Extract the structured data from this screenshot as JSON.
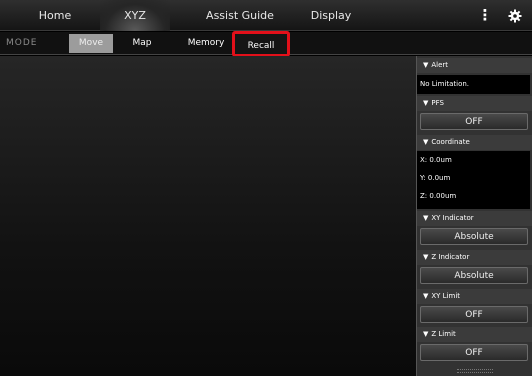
{
  "topnav": {
    "home": "Home",
    "xyz": "XYZ",
    "assist_guide": "Assist Guide",
    "display": "Display",
    "more_icon": "vertical-ellipsis",
    "settings_icon": "gear"
  },
  "modebar": {
    "label": "MODE",
    "tabs": [
      "Move",
      "Map",
      "Memory",
      "Recall"
    ],
    "selected": "Move",
    "highlighted": "Recall"
  },
  "panel": {
    "alert": {
      "header": "Alert",
      "text": "No Limitation."
    },
    "pfs": {
      "header": "PFS",
      "value": "OFF"
    },
    "coordinate": {
      "header": "Coordinate",
      "x": "X: 0.0um",
      "y": "Y: 0.0um",
      "z": "Z: 0.00um"
    },
    "xy_indicator": {
      "header": "XY Indicator",
      "value": "Absolute"
    },
    "z_indicator": {
      "header": "Z Indicator",
      "value": "Absolute"
    },
    "xy_limit": {
      "header": "XY Limit",
      "value": "OFF"
    },
    "z_limit": {
      "header": "Z Limit",
      "value": "OFF"
    }
  },
  "colors": {
    "highlight_border": "#e3101a",
    "selected_tab_bg": "#9c9c9c",
    "panel_bg": "#323232"
  }
}
